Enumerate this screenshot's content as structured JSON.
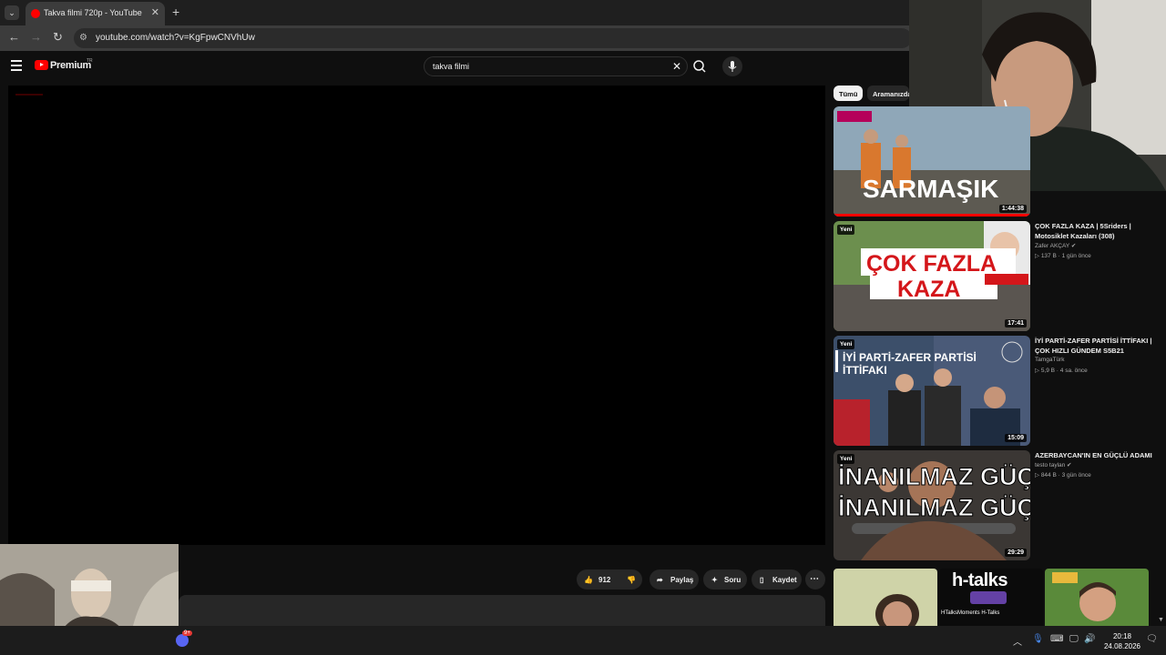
{
  "browser": {
    "tab_title": "Takva filmi 720p - YouTube",
    "tab_close": "✕",
    "new_tab": "+",
    "url": "youtube.com/watch?v=KgFpwCNVhUw"
  },
  "header": {
    "logo_text": "Premium",
    "logo_region": "TR",
    "search_query": "takva filmi",
    "search_clear": "✕"
  },
  "chips": [
    "Tümü",
    "Aramanızda"
  ],
  "actions": {
    "likes": "912",
    "share": "Paylaş",
    "ask": "Soru",
    "save": "Kaydet"
  },
  "recommendations": [
    {
      "title": "",
      "channel": "",
      "meta": "",
      "duration": "1:44:38",
      "badge": "",
      "thumb_text": "SARMAŞIK"
    },
    {
      "title": "ÇOK FAZLA KAZA | 5Sriders | Motosiklet Kazaları (308)",
      "channel": "Zafer AKÇAY ✔",
      "views": "137 B",
      "age": "1 gün önce",
      "duration": "17:41",
      "badge": "Yeni",
      "thumb_text": "ÇOK FAZLA KAZA"
    },
    {
      "title": "İYİ PARTİ-ZAFER PARTİSİ İTTİFAKI | ÇOK HIZLI GÜNDEM S5B21",
      "channel": "TamgaTürk",
      "views": "5,9 B",
      "age": "4 sa. önce",
      "duration": "15:09",
      "badge": "Yeni",
      "thumb_text": "İYİ PARTİ-ZAFER PARTİSİ İTTİFAKI"
    },
    {
      "title": "AZERBAYCAN'IN EN GÜÇLÜ ADAMI",
      "channel": "testo taylan ✔",
      "views": "844 B",
      "age": "3 gün önce",
      "duration": "29:29",
      "badge": "Yeni",
      "thumb_text": "İNANILMAZ GÜÇ"
    }
  ],
  "bottom_row": {
    "htalks": "h-talks",
    "htalks_sub": "HTalksMoments  H-Talks"
  },
  "taskbar": {
    "time": "20:18",
    "date": "24.08.2026",
    "badge": "9+"
  }
}
